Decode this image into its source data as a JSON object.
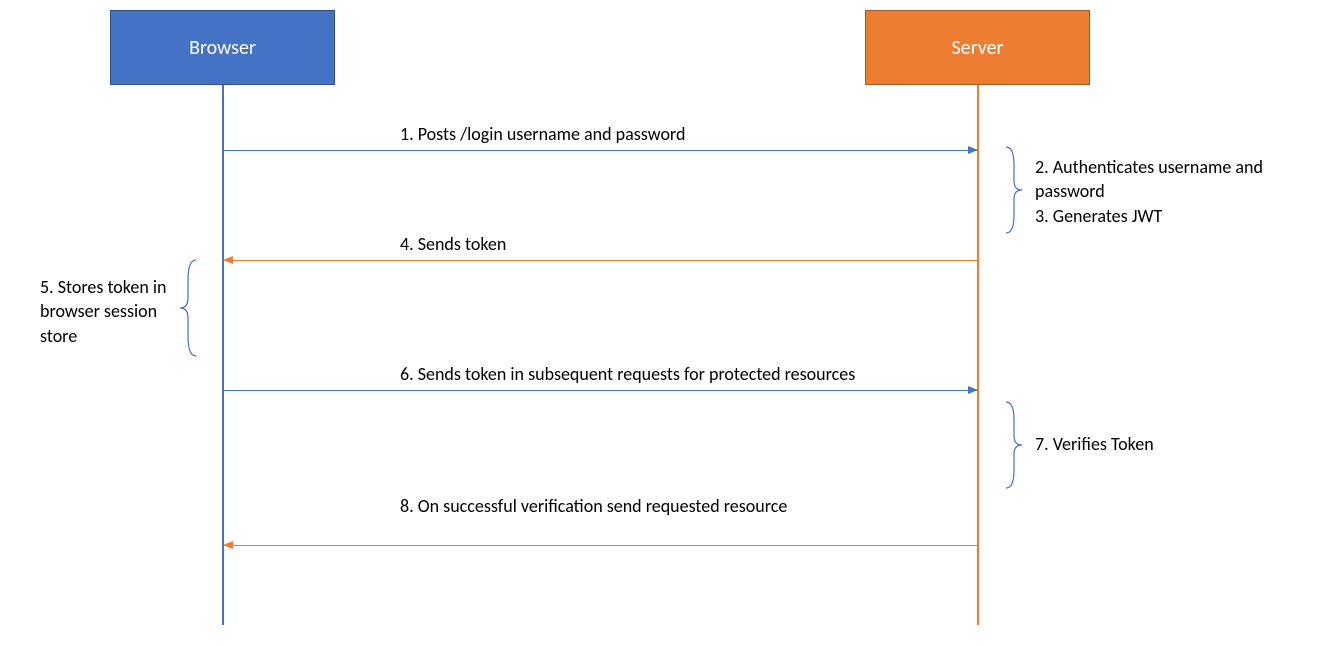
{
  "actors": {
    "browser": "Browser",
    "server": "Server"
  },
  "messages": {
    "m1": "1. Posts /login username and password",
    "m4": "4. Sends token",
    "m6": "6. Sends token in subsequent requests for protected resources",
    "m8": "8. On successful verification send requested resource"
  },
  "notes": {
    "n2_3": "2. Authenticates username and password\n3. Generates JWT",
    "n5": "5. Stores token in browser session store",
    "n7": "7. Verifies Token"
  },
  "colors": {
    "browser": "#4472C4",
    "server": "#ED7D31"
  }
}
